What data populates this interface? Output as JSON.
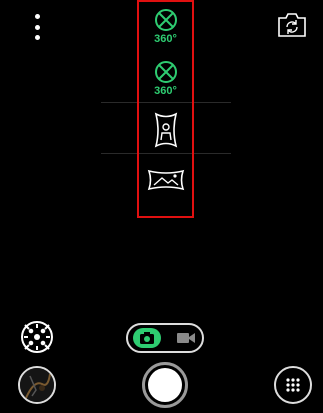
{
  "top_bar": {
    "menu_icon": "more-vertical-icon",
    "switch_camera_icon": "switch-camera-icon"
  },
  "mode_menu": {
    "items": [
      {
        "icon": "sphere-360-icon",
        "label": "360°"
      },
      {
        "icon": "sphere-360-icon",
        "label": "360°"
      },
      {
        "icon": "portrait-panorama-icon",
        "label": ""
      },
      {
        "icon": "landscape-panorama-icon",
        "label": ""
      }
    ]
  },
  "bottom_bar": {
    "effects_icon": "effects-icon",
    "mode_toggle": {
      "photo_icon": "camera-icon",
      "video_icon": "video-icon",
      "selected": "photo"
    },
    "gallery_icon": "gallery-thumbnail",
    "shutter_icon": "shutter-button",
    "grid_icon": "grid-dots-icon"
  },
  "colors": {
    "accent": "#2ecc71",
    "highlight_border": "#e01010",
    "background": "#000000"
  }
}
